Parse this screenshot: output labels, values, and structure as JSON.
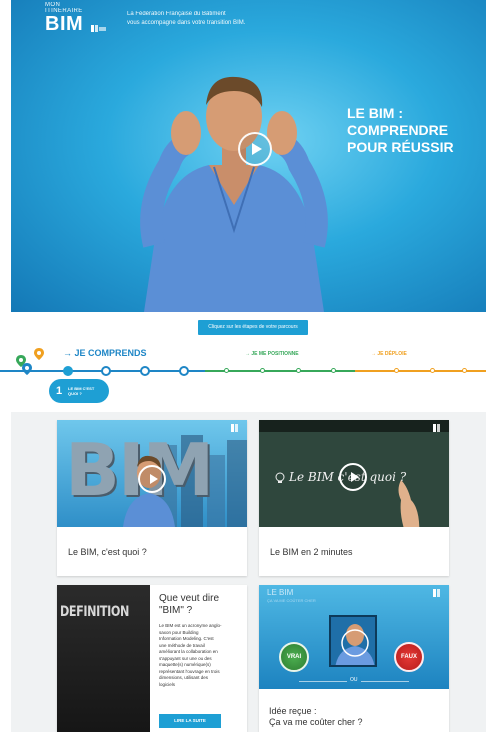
{
  "hero": {
    "logo_sub1": "MON",
    "logo_sub2": "ITINERAIRE",
    "logo_main": "BIM",
    "tagline_line1": "La Fédération Française du Bâtiment",
    "tagline_line2": "vous accompagne dans votre transition BIM.",
    "title_line1": "LE BIM :",
    "title_line2": "COMPRENDRE",
    "title_line3": "POUR RÉUSSIR",
    "play_icon": "play-icon"
  },
  "journey": {
    "cta_label": "Cliquez sur les étapes de votre parcours",
    "step1_label": "→ JE COMPRENDS",
    "step2_label": "→ JE ME POSITIONNE",
    "step3_label": "→ JE DÉPLOIE",
    "badge_num": "1",
    "badge_text_line1": "LE BIM C'EST",
    "badge_text_line2": "QUOI ?",
    "colors": {
      "step1": "#1e86c6",
      "step2": "#37a85a",
      "step3": "#f0a020"
    }
  },
  "cards": {
    "c1": {
      "title": "Le BIM, c'est quoi ?",
      "thumb_text": "BIM"
    },
    "c2": {
      "title": "Le BIM en 2 minutes",
      "thumb_text": "Le BIM c'est quoi ?"
    },
    "c3": {
      "thumb_text": "DEFINITION",
      "heading_line1": "Que veut dire",
      "heading_line2": "\"BIM\" ?",
      "body_lines": [
        "Le BIM est un acronyme anglo-",
        "saxon pour Building",
        "Information Modeling. C'est",
        "une méthode de travail",
        "améliorant la collaboration en",
        "s'appuyant sur une ou des",
        "maquette(s) numérique(s)",
        "représentant l'ouvrage en trois",
        "dimensions, utilisant des",
        "logiciels"
      ],
      "button": "LIRE LA SUITE"
    },
    "c4": {
      "thumb_title": "LE BIM",
      "thumb_sub": "ÇA VA ME COÛTER CHER",
      "vrai": "VRAI",
      "faux": "FAUX",
      "ou": "OU",
      "title_line1": "Idée reçue :",
      "title_line2": "Ça va me coûter cher ?"
    }
  }
}
